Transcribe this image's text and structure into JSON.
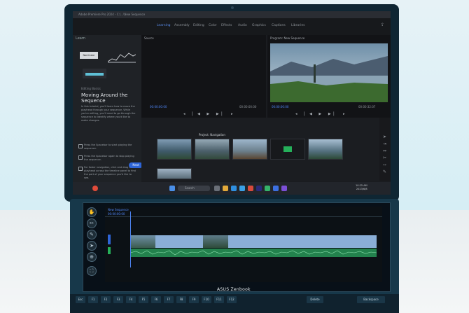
{
  "window": {
    "title": "Adobe Premiere Pro 2024 - C:\\...\\New Sequence"
  },
  "menu": {
    "items": [
      "Learning",
      "Assembly",
      "Editing",
      "Color",
      "Effects",
      "Audio",
      "Graphics",
      "Captions",
      "Libraries"
    ],
    "active_index": 0
  },
  "learn_panel": {
    "header_label": "Learn",
    "badge_text": "Nonlinear",
    "subtitle": "Editing Basics",
    "title": "Moving Around the Sequence",
    "body": "In this tutorial, you'll learn how to move the playhead through your sequence. While you're editing, you'll need to go through the sequence to identify where you'd like to make changes.",
    "steps": [
      "Press the Spacebar to start playing the sequence.",
      "Press the Spacebar again to stop playing the sequence.",
      "For faster navigation, click and drag the playhead across the timeline panel to find the part of your sequence you'd like to see."
    ],
    "next_label": "Next"
  },
  "source_monitor": {
    "label": "Source",
    "timecode_left": "00:00:00:00",
    "timecode_right": "00:00:00:00"
  },
  "program_monitor": {
    "label": "Program: New Sequence",
    "timecode_left": "00:00:00:00",
    "timecode_right": "00:00:32:07"
  },
  "project_panel": {
    "tab_label": "Project: Navigation",
    "clip_names": [
      "Mountain.mp4",
      "Hiker.mp4",
      "Dock.mp4",
      "Transition",
      "Lake.mp4"
    ]
  },
  "taskbar": {
    "search_placeholder": "Search",
    "time": "10:25 AM",
    "date": "2023/6/8"
  },
  "sidebar_icons": [
    "hand-tool",
    "razor-tool",
    "pen-tool",
    "selection-tool",
    "zoom-tool",
    "ripple-tool"
  ],
  "timeline": {
    "title": "New Sequence",
    "playhead_timecode": "00:00:00:00"
  },
  "brand": {
    "name": "ASUS Zenbook"
  },
  "keyboard": {
    "keys": [
      "Esc",
      "F1",
      "F2",
      "F3",
      "F4",
      "F5",
      "F6",
      "F7",
      "F8",
      "F9",
      "F10",
      "F11",
      "F12",
      "Delete",
      "Backspace"
    ]
  },
  "colors": {
    "accent": "#4f86f7",
    "audio_clip": "#23824d",
    "video_clip": "#8aaed6",
    "lid": "#0f2633"
  }
}
